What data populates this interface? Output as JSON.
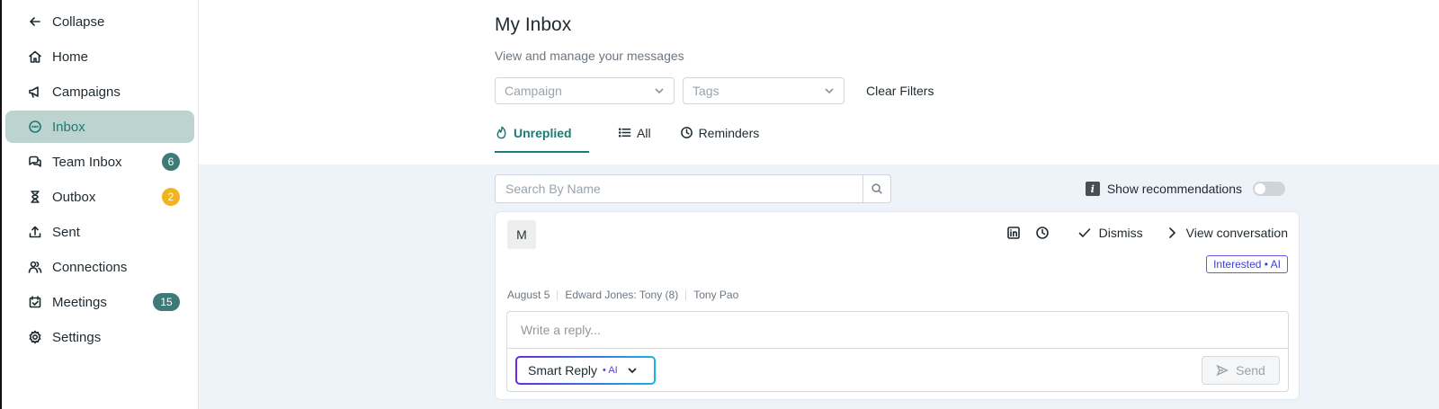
{
  "sidebar": {
    "collapse_label": "Collapse",
    "items": [
      {
        "label": "Home",
        "icon": "home-icon"
      },
      {
        "label": "Campaigns",
        "icon": "megaphone-icon"
      },
      {
        "label": "Inbox",
        "icon": "chat-bubble-icon",
        "active": true
      },
      {
        "label": "Team Inbox",
        "icon": "team-chat-icon",
        "badge": "6"
      },
      {
        "label": "Outbox",
        "icon": "hourglass-icon",
        "badge": "2"
      },
      {
        "label": "Sent",
        "icon": "upload-tray-icon"
      },
      {
        "label": "Connections",
        "icon": "users-icon"
      },
      {
        "label": "Meetings",
        "icon": "calendar-check-icon",
        "badge": "15"
      },
      {
        "label": "Settings",
        "icon": "gear-icon"
      }
    ]
  },
  "header": {
    "title": "My Inbox",
    "subtitle": "View and manage your messages"
  },
  "filters": {
    "campaign_placeholder": "Campaign",
    "tags_placeholder": "Tags",
    "clear_label": "Clear Filters"
  },
  "tabs": [
    {
      "label": "Unreplied",
      "icon": "flame-icon",
      "active": true
    },
    {
      "label": "All",
      "icon": "list-icon"
    },
    {
      "label": "Reminders",
      "icon": "clock-icon"
    }
  ],
  "search": {
    "placeholder": "Search By Name"
  },
  "recommendations": {
    "info_glyph": "i",
    "label": "Show recommendations",
    "enabled": false
  },
  "message": {
    "avatar_initial": "M",
    "dismiss_label": "Dismiss",
    "view_label": "View conversation",
    "tag": "Interested",
    "tag_ai": "• AI",
    "date": "August 5",
    "campaign": "Edward Jones: Tony (8)",
    "sender": "Tony Pao",
    "reply_placeholder": "Write a reply...",
    "smart_reply_label": "Smart Reply",
    "smart_reply_ai": "• AI",
    "send_label": "Send"
  },
  "colors": {
    "accent": "#1d7a72",
    "active_bg": "#bcd3cf",
    "badge_teal": "#3f7b76",
    "badge_yellow": "#f2b41c",
    "ai_purple": "#5541d8",
    "content_bg": "#eef3f9"
  }
}
